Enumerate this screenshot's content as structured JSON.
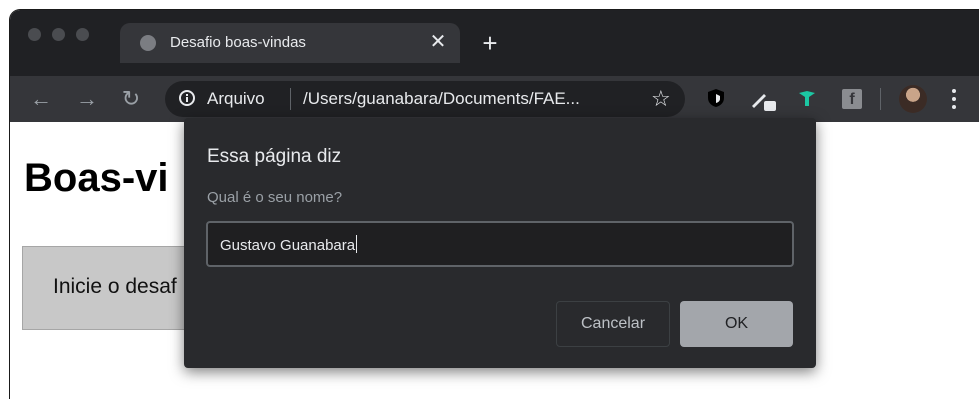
{
  "tab": {
    "title": "Desafio boas-vindas",
    "close_glyph": "✕"
  },
  "new_tab_glyph": "+",
  "nav": {
    "back": "←",
    "forward": "→",
    "reload": "↻"
  },
  "omnibox": {
    "scheme_label": "Arquivo",
    "url": "/Users/guanabara/Documents/FAE...",
    "star_glyph": "☆"
  },
  "extensions": {
    "facebook_label": "f"
  },
  "page": {
    "heading": "Boas-vi",
    "box_text": "Inicie o desaf"
  },
  "dialog": {
    "title": "Essa página diz",
    "message": "Qual é o seu nome?",
    "input_value": "Gustavo Guanabara",
    "cancel_label": "Cancelar",
    "ok_label": "OK"
  },
  "colors": {
    "tabstrip": "#202124",
    "toolbar": "#35363a",
    "dialog": "#292a2d",
    "ok_button": "#a3a6ab",
    "accent_leaf": "#1cc7a3"
  }
}
